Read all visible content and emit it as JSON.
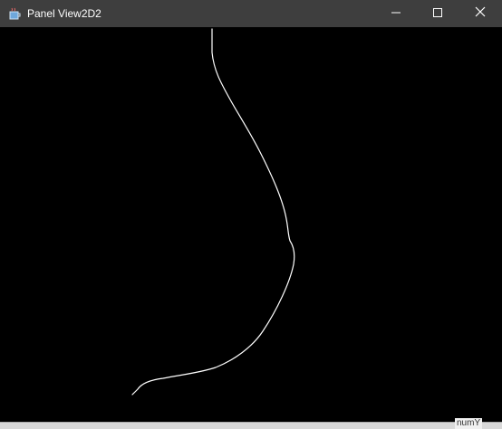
{
  "window": {
    "title": "Panel View2D2",
    "icon": "java-cup-icon",
    "controls": {
      "minimize_icon": "minimize-icon",
      "maximize_icon": "maximize-icon",
      "close_icon": "close-icon"
    }
  },
  "background_window": {
    "partial_label": "numY"
  },
  "colors": {
    "titlebar": "#3e3e3e",
    "canvas": "#000000",
    "curve": "#ffffff"
  }
}
